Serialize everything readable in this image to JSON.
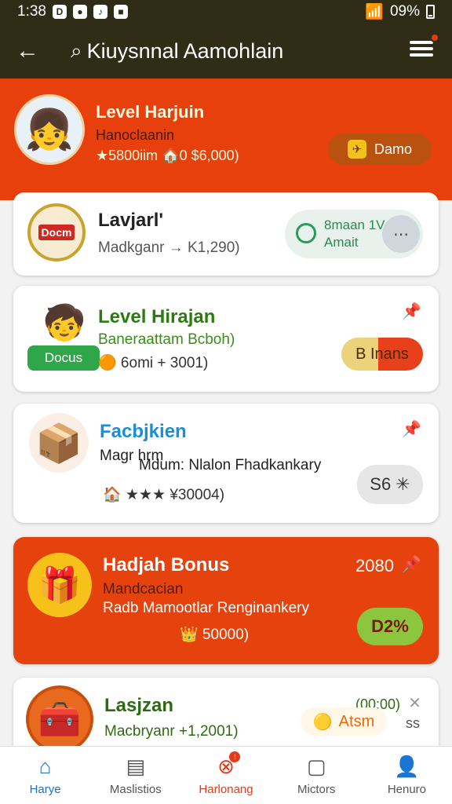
{
  "status_bar": {
    "time": "1:38",
    "battery": "09%"
  },
  "app_bar": {
    "title": "Kiuysnnal Aamohlain"
  },
  "hero": {
    "title": "Level Harjuin",
    "subtitle": "Hanoclaanin",
    "stats": "★5800iim 🏠0 $6,000)",
    "button_label": "Damo"
  },
  "cards": [
    {
      "title": "Lavjarl'",
      "subtitle": "Madkganr → K1,290)",
      "logo_text": "Docm",
      "pill_line1": "8maan 1V",
      "pill_line2": "Amait"
    },
    {
      "title": "Level Hirajan",
      "subtitle": "Baneraattam Bcboh)",
      "stats": "🟠 6omi + 3001)",
      "badge": "Docus",
      "button_label": "B Inans"
    },
    {
      "title": "Facbjkien",
      "line1": "Magr hrm",
      "line2": "Mdum: Nlalon Fhadkankary",
      "stats": "🏠 ★★★ ¥30004)",
      "button_label": "S6 ✳"
    },
    {
      "title": "Hadjah Bonus",
      "amount": "2080",
      "subtitle": "Mandcacian",
      "line2": "Radb Mamootlar Renginankery",
      "stats": "👑 50000)",
      "button_label": "D2%"
    },
    {
      "title": "Lasjzan",
      "subtitle": "Macbryanr +1,2001)",
      "time": "(00:00)",
      "pill_label": "Atsm",
      "extra": "ss"
    }
  ],
  "nav": [
    {
      "label": "Harye",
      "icon": "home-icon"
    },
    {
      "label": "Maslistios",
      "icon": "chart-icon"
    },
    {
      "label": "Harlonang",
      "icon": "close-circle-icon"
    },
    {
      "label": "Mictors",
      "icon": "message-icon"
    },
    {
      "label": "Henuro",
      "icon": "user-icon"
    }
  ]
}
